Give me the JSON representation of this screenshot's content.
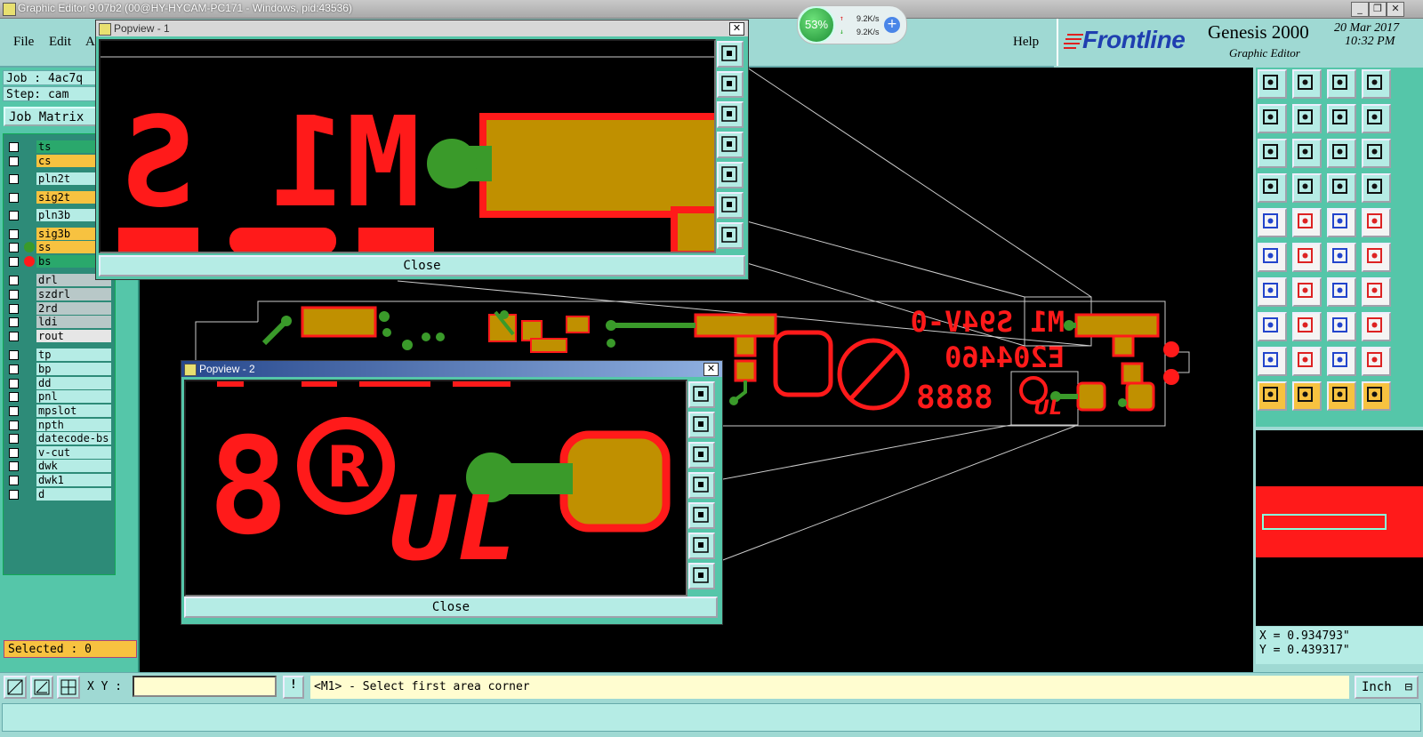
{
  "window": {
    "title": "Graphic Editor 9.07b2 (00@HY-HYCAM-PC171 - Windows, pid:43536)",
    "minimize": "_",
    "restore": "❐",
    "close": "✕"
  },
  "menu": {
    "file": "File",
    "edit": "Edit",
    "a": "A",
    "help": "Help"
  },
  "branding": {
    "company": "Frontline",
    "product": "Genesis 2000",
    "subtitle": "Graphic Editor",
    "date": "20 Mar 2017",
    "time": "10:32 PM",
    "logo_color": "#1f3fb0"
  },
  "network_meter": {
    "percent": "53%",
    "upload": "9.2K/s",
    "download": "9.2K/s",
    "plus": "+"
  },
  "left_panel": {
    "job": "Job : 4ac7q",
    "step": "Step: cam",
    "job_matrix": "Job Matrix",
    "selected": "Selected : 0",
    "layers": [
      {
        "name": "ts",
        "color": "#2aa86c",
        "dot": ""
      },
      {
        "name": "cs",
        "color": "#f7c240",
        "dot": ""
      },
      {
        "name": "pln2t",
        "color": "#b5ece5",
        "dot": ""
      },
      {
        "name": "sig2t",
        "color": "#f7c240",
        "dot": ""
      },
      {
        "name": "pln3b",
        "color": "#b5ece5",
        "dot": ""
      },
      {
        "name": "sig3b",
        "color": "#f7c240",
        "dot": ""
      },
      {
        "name": "ss",
        "color": "#f7c240",
        "dot": "#3a9a2a"
      },
      {
        "name": "bs",
        "color": "#2aa86c",
        "dot": "#ff1a1a"
      },
      {
        "name": "drl",
        "color": "#b8c8c8",
        "dot": ""
      },
      {
        "name": "szdrl",
        "color": "#b8c8c8",
        "dot": ""
      },
      {
        "name": "2rd",
        "color": "#b8c8c8",
        "dot": ""
      },
      {
        "name": "ldi",
        "color": "#b8c8c8",
        "dot": ""
      },
      {
        "name": "rout",
        "color": "#e6e6e6",
        "dot": ""
      },
      {
        "name": "tp",
        "color": "#b5ece5",
        "dot": ""
      },
      {
        "name": "bp",
        "color": "#b5ece5",
        "dot": ""
      },
      {
        "name": "dd",
        "color": "#b5ece5",
        "dot": ""
      },
      {
        "name": "pnl",
        "color": "#b5ece5",
        "dot": ""
      },
      {
        "name": "mpslot",
        "color": "#b5ece5",
        "dot": ""
      },
      {
        "name": "npth",
        "color": "#b5ece5",
        "dot": ""
      },
      {
        "name": "datecode-bs",
        "color": "#b5ece5",
        "dot": ""
      },
      {
        "name": "v-cut",
        "color": "#b5ece5",
        "dot": ""
      },
      {
        "name": "dwk",
        "color": "#b5ece5",
        "dot": ""
      },
      {
        "name": "dwk1",
        "color": "#b5ece5",
        "dot": ""
      },
      {
        "name": "d",
        "color": "#b5ece5",
        "dot": ""
      }
    ]
  },
  "canvas": {
    "silk_line1": "M1 S94V-0",
    "silk_line2": "E204460",
    "silk_line3": "8888",
    "ul_mark": "UL"
  },
  "popview1": {
    "title": "Popview - 1",
    "close_label": "Close",
    "text": "M1 S"
  },
  "popview2": {
    "title": "Popview - 2",
    "close_label": "Close",
    "digit": "8",
    "ul_mark": "UL"
  },
  "coords": {
    "x": "X = 0.934793\"",
    "y": "Y = 0.439317\""
  },
  "bottom": {
    "xy_label": "X Y :",
    "xy_value": "",
    "warn": "!",
    "prompt": "<M1> - Select first area corner",
    "unit": "Inch"
  },
  "colors": {
    "red": "#ff1a1a",
    "gold": "#c09000",
    "green": "#3a9a2a",
    "panel": "#55c6a9",
    "light": "#b5ece5"
  }
}
